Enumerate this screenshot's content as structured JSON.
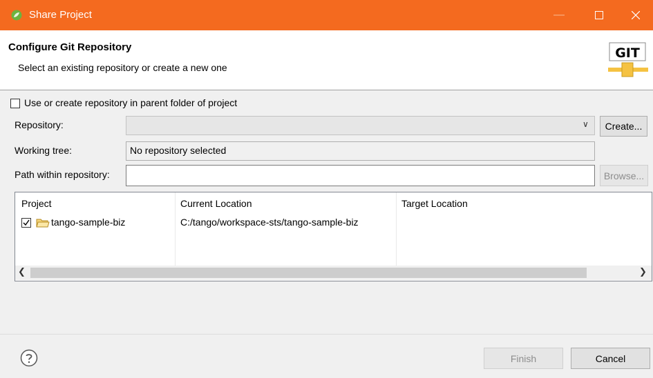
{
  "window": {
    "title": "Share Project",
    "app_icon": "spring-leaf-icon",
    "controls": [
      "minimize-icon",
      "maximize-icon",
      "close-icon"
    ],
    "accent_color": "#f46a1f"
  },
  "header": {
    "title": "Configure Git Repository",
    "subtitle": "Select an existing repository or create a new one",
    "logo_text": "GIT"
  },
  "form": {
    "use_parent": {
      "label": "Use or create repository in parent folder of project",
      "checked": false
    },
    "repository": {
      "label": "Repository:",
      "value": "",
      "create_label": "Create..."
    },
    "working_tree": {
      "label": "Working tree:",
      "value": "No repository selected"
    },
    "path": {
      "label": "Path within repository:",
      "value": "",
      "browse_label": "Browse..."
    }
  },
  "table": {
    "columns": [
      "Project",
      "Current Location",
      "Target Location"
    ],
    "rows": [
      {
        "checked": true,
        "project": "tango-sample-biz",
        "current": "C:/tango/workspace-sts/tango-sample-biz",
        "target": ""
      }
    ]
  },
  "footer": {
    "finish_label": "Finish",
    "cancel_label": "Cancel",
    "help_icon": "help-icon"
  }
}
